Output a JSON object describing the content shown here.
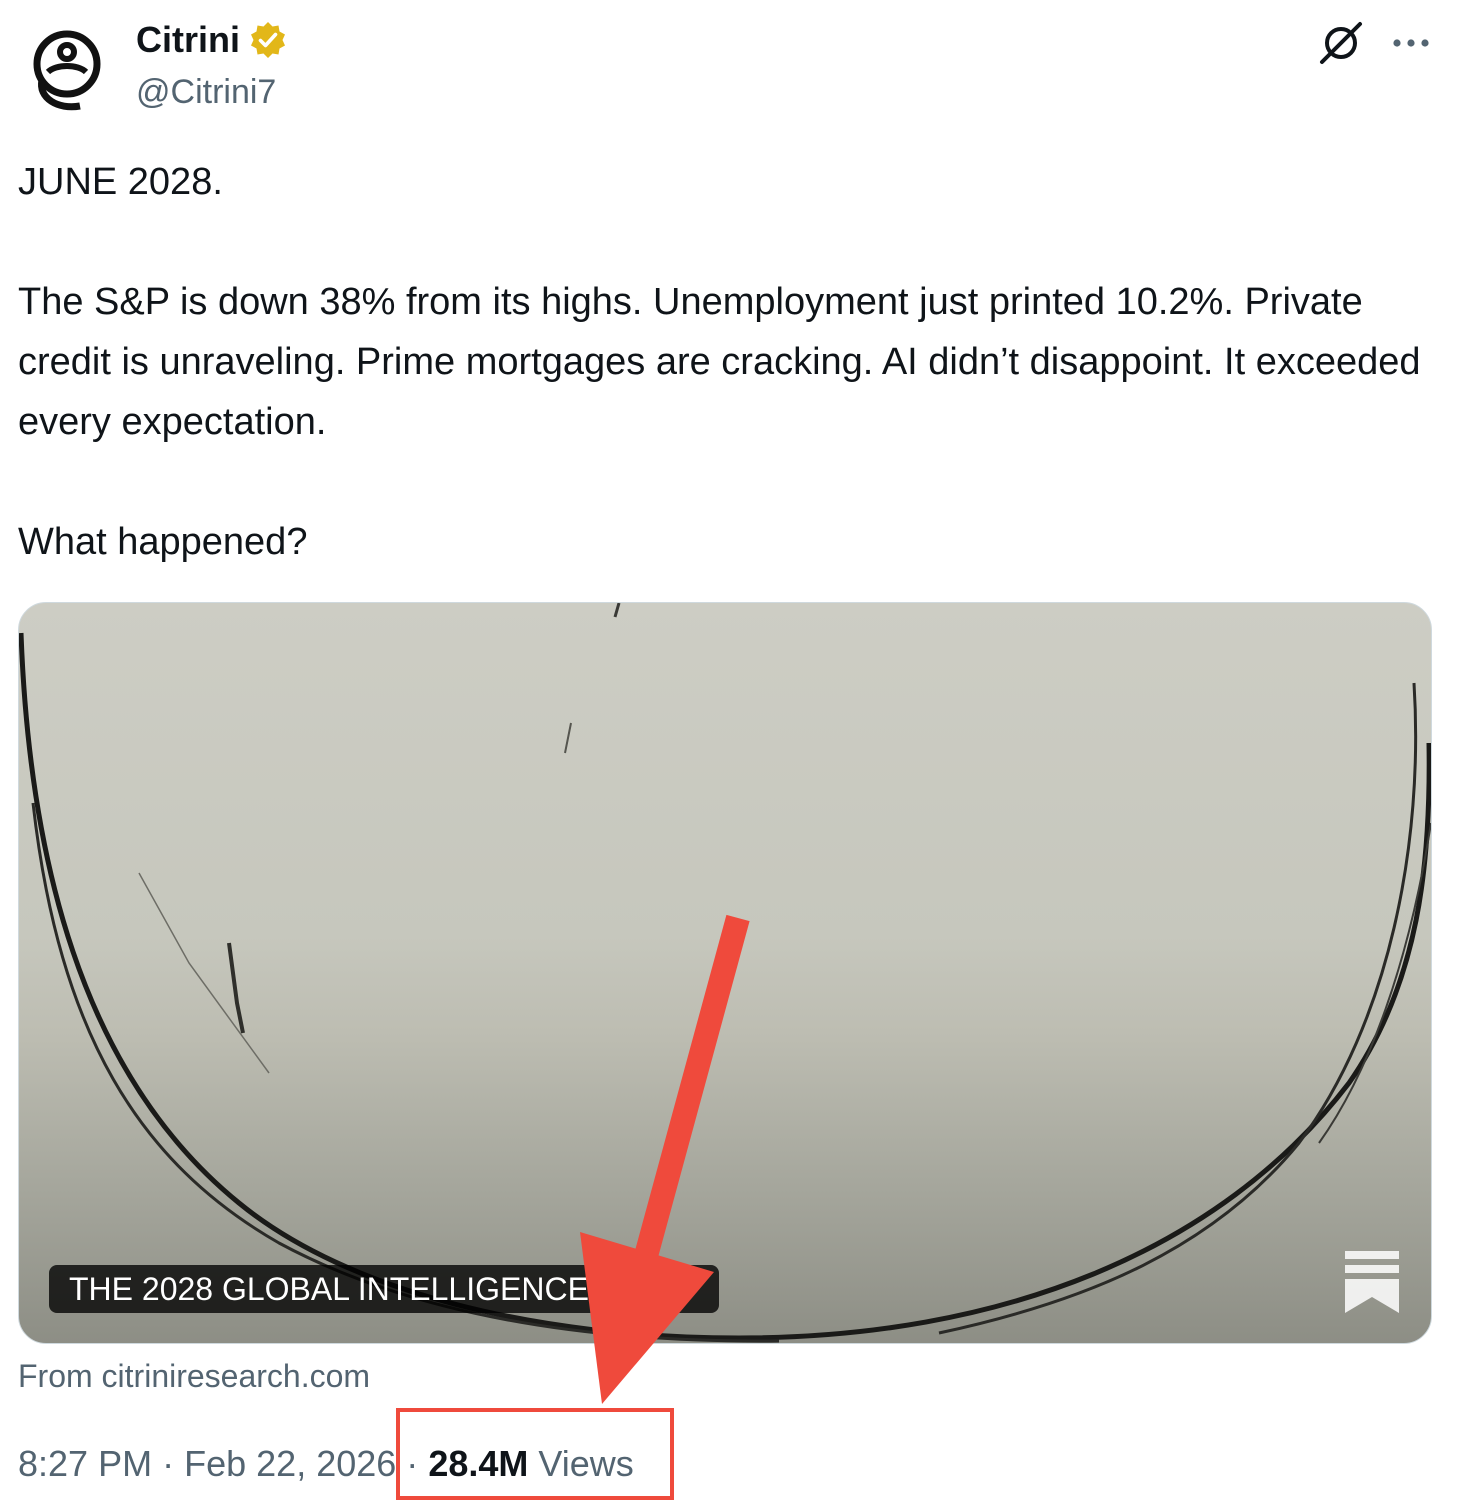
{
  "author": {
    "display_name": "Citrini",
    "handle": "@Citrini7",
    "avatar_icon": "citrini-logo",
    "verified_icon": "verified-gold-badge-icon"
  },
  "header_icons": [
    "grok-icon",
    "more-icon"
  ],
  "tweet": {
    "text": "JUNE 2028.\n\nThe S&P is down 38% from its highs. Unemployment just printed 10.2%. Private credit is unraveling. Prime mortgages are cracking. AI didn’t disappoint. It exceeded every expectation.\n\nWhat happened?"
  },
  "card": {
    "title": "THE 2028 GLOBAL INTELLIGENCE",
    "brand_icon": "substack-icon",
    "source": "From citriniresearch.com"
  },
  "meta": {
    "time": "8:27 PM",
    "separator": "·",
    "date": "Feb 22, 2026",
    "views_count": "28.4M",
    "views_label": "Views"
  },
  "annotation": {
    "arrow_color": "#ef4a3c",
    "box_color": "#ef4a3c"
  },
  "colors": {
    "text_primary": "#0f1419",
    "text_secondary": "#536471",
    "verified_gold": "#e2b719"
  }
}
